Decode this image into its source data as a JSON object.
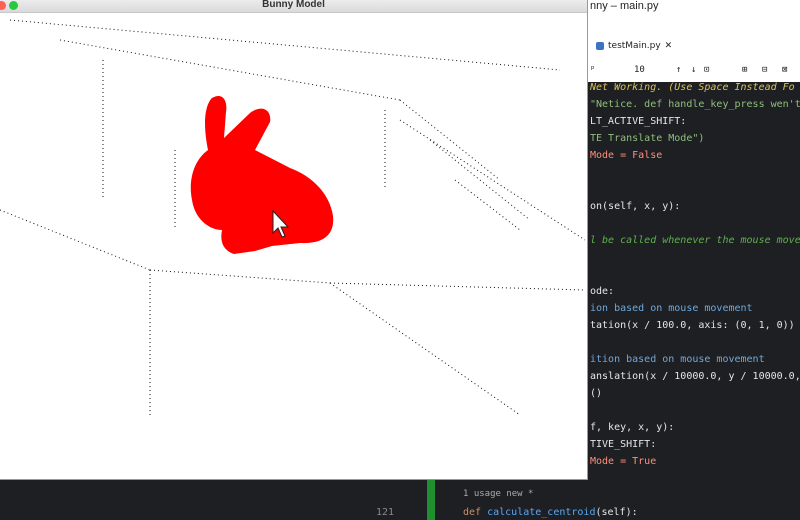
{
  "colors": {
    "bunny": "#ff0000",
    "close": "#ff5f57",
    "zoom": "#28c840",
    "ide_bg": "#1e1f22"
  },
  "window": {
    "title": "Bunny Model"
  },
  "ide": {
    "title": "nny – main.py",
    "tab": "testMain.py",
    "toolbar": {
      "num": "10",
      "pre": "ᵖ"
    },
    "lines": [
      {
        "text": "Net Working. (Use Space Instead Fo",
        "color": "#d8c25a",
        "italic": true
      },
      {
        "text": "\"Netice. def handle_key_press wen't",
        "color": "#8fbf7f",
        "italic": false
      },
      {
        "text": "LT_ACTIVE_SHIFT:",
        "color": "#e6e6e6",
        "italic": false
      },
      {
        "text": "TE Translate Mode\")",
        "color": "#8fbf7f",
        "italic": false
      },
      {
        "text": "Mode = False",
        "color": "#ff8f7a",
        "italic": false
      },
      {
        "text": "",
        "color": "#e6e6e6",
        "italic": false
      },
      {
        "text": "",
        "color": "#e6e6e6",
        "italic": false
      },
      {
        "text": "on(self, x, y):",
        "color": "#e6e6e6",
        "italic": false
      },
      {
        "text": "",
        "color": "#e6e6e6",
        "italic": false
      },
      {
        "text": "l be called whenever the mouse move",
        "color": "#5fb04f",
        "italic": true
      },
      {
        "text": "",
        "color": "#e6e6e6",
        "italic": false
      },
      {
        "text": "",
        "color": "#e6e6e6",
        "italic": false
      },
      {
        "text": "ode:",
        "color": "#e6e6e6",
        "italic": false
      },
      {
        "text": "ion based on mouse movement",
        "color": "#6fa8dc",
        "italic": false
      },
      {
        "text": "tation(x / 100.0, axis: (0, 1, 0))",
        "color": "#e6e6e6",
        "italic": false
      },
      {
        "text": "",
        "color": "#e6e6e6",
        "italic": false
      },
      {
        "text": "ition based on mouse movement",
        "color": "#6fa8dc",
        "italic": false
      },
      {
        "text": "anslation(x / 10000.0, y / 10000.0,",
        "color": "#e6e6e6",
        "italic": false
      },
      {
        "text": "()",
        "color": "#e6e6e6",
        "italic": false
      },
      {
        "text": "",
        "color": "#e6e6e6",
        "italic": false
      },
      {
        "text": "f, key, x, y):",
        "color": "#e6e6e6",
        "italic": false
      },
      {
        "text": "TIVE_SHIFT:",
        "color": "#e6e6e6",
        "italic": false
      },
      {
        "text": "Mode = True",
        "color": "#ff8f7a",
        "italic": false
      }
    ],
    "bottom": {
      "usage": "1 usage   new *",
      "line_no": "121",
      "code": "def calculate_centroid(self):"
    }
  }
}
